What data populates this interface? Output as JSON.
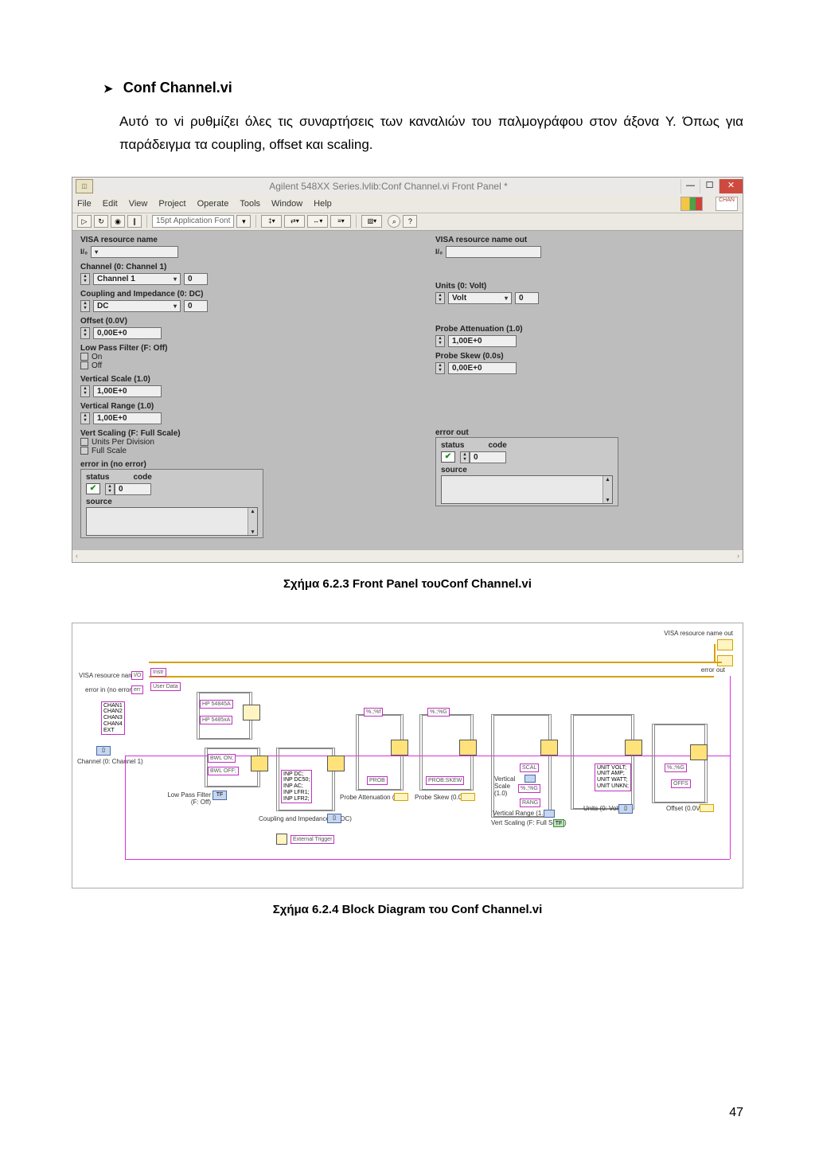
{
  "section": {
    "bullet": "➤",
    "title": "Conf Channel.vi",
    "body": "Αυτό το vi ρυθμίζει όλες τις συναρτήσεις των καναλιών του παλμογράφου στον άξονα Υ. Όπως για παράδειγμα τα coupling, offset και scaling."
  },
  "fig1": {
    "window_title": "Agilent 548XX Series.lvlib:Conf Channel.vi Front Panel *",
    "menu": [
      "File",
      "Edit",
      "View",
      "Project",
      "Operate",
      "Tools",
      "Window",
      "Help"
    ],
    "toolbar_font": "15pt Application Font",
    "right_icon_text": "CHAN",
    "left": {
      "visa_label": "VISA resource name",
      "visa_value": "",
      "channel_label": "Channel (0: Channel 1)",
      "channel_value": "Channel 1",
      "channel_num": "0",
      "coupling_label": "Coupling and Impedance (0: DC)",
      "coupling_value": "DC",
      "coupling_num": "0",
      "offset_label": "Offset (0.0V)",
      "offset_value": "0,00E+0",
      "lpf_label": "Low Pass Filter (F: Off)",
      "lpf_opt1": "On",
      "lpf_opt2": "Off",
      "vscale_label": "Vertical Scale (1.0)",
      "vscale_value": "1,00E+0",
      "vrange_label": "Vertical Range (1.0)",
      "vrange_value": "1,00E+0",
      "vscaling_label": "Vert Scaling (F: Full Scale)",
      "vscaling_opt1": "Units Per Division",
      "vscaling_opt2": "Full Scale",
      "errin_label": "error in (no error)",
      "status": "status",
      "code": "code",
      "code_val": "0",
      "source": "source"
    },
    "right": {
      "visa_out_label": "VISA resource name out",
      "units_label": "Units (0: Volt)",
      "units_value": "Volt",
      "units_num": "0",
      "patt_label": "Probe Attenuation (1.0)",
      "patt_value": "1,00E+0",
      "pskew_label": "Probe Skew (0.0s)",
      "pskew_value": "0,00E+0",
      "errout_label": "error out",
      "status": "status",
      "code": "code",
      "code_val": "0",
      "source": "source"
    }
  },
  "caption1": "Σχήμα 6.2.3 Front Panel τουConf Channel.vi",
  "fig2": {
    "visa_in": "VISA resource name",
    "visa_out": "VISA resource name out",
    "err_in": "error in (no error)",
    "err_out": "error out",
    "user_data": "User Data",
    "instr": "Instr",
    "hp1": "HP 54845A",
    "hp2": "HP 5485xA",
    "channels": "CHAN1\nCHAN2\nCHAN3\nCHAN4\nEXT",
    "channel_ctrl": "Channel (0: Channel 1)",
    "bwl_on": "BWL ON;",
    "bwl_off": "BWL OFF;",
    "lpf_ctrl": "Low Pass Filter (F: Off)",
    "inp_list": "INP DC;\nINP DC50;\nINP AC;\nINP LFR1;\nINP LFR2;",
    "coupling_ctrl": "Coupling and Impedance (0: DC)",
    "ext_trig": "External Trigger",
    "fmt1": "%.;%f",
    "fmt2": "%.;%G",
    "prob": "PROB",
    "prob_ctrl": "Probe Attenuation (1.0)",
    "prob_skew": "PROB:SKEW",
    "pskew_ctrl": "Probe Skew (0.0s)",
    "scal": "SCAL",
    "vscale_ctrl": "Vertical Scale (1.0)",
    "rang": "RANG",
    "vrange_ctrl": "Vertical Range (1.0)",
    "vscaling_ctrl": "Vert Scaling (F: Full Scale)",
    "unit_list": "UNIT VOLT;\nUNIT AMP;\nUNIT WATT;\nUNIT UNKN;",
    "units_ctrl": "Units (0: Volt)",
    "offs": "OFFS",
    "offset_ctrl": "Offset (0.0V)"
  },
  "caption2": "Σχήμα 6.2.4 Block Diagram του Conf Channel.vi",
  "page_number": "47"
}
